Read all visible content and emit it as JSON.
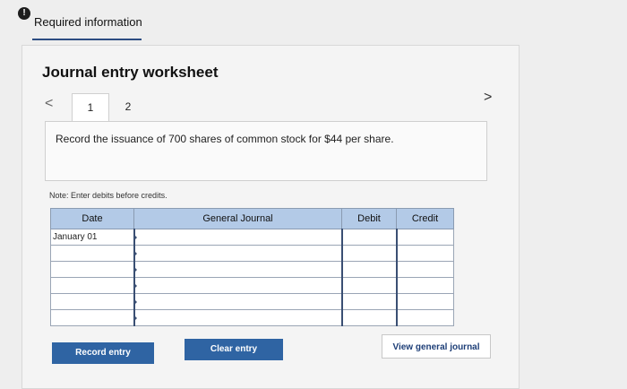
{
  "info": {
    "icon": "!",
    "label": "Required information"
  },
  "worksheet": {
    "title": "Journal entry worksheet",
    "tabs": [
      "1",
      "2"
    ],
    "nav_prev": "<",
    "nav_next": ">",
    "prompt": "Record the issuance of 700 shares of common stock for $44 per share.",
    "note": "Note: Enter debits before credits."
  },
  "table": {
    "headers": {
      "date": "Date",
      "journal": "General Journal",
      "debit": "Debit",
      "credit": "Credit"
    },
    "rows": [
      {
        "date": "January 01",
        "journal": "",
        "debit": "",
        "credit": ""
      },
      {
        "date": "",
        "journal": "",
        "debit": "",
        "credit": ""
      },
      {
        "date": "",
        "journal": "",
        "debit": "",
        "credit": ""
      },
      {
        "date": "",
        "journal": "",
        "debit": "",
        "credit": ""
      },
      {
        "date": "",
        "journal": "",
        "debit": "",
        "credit": ""
      },
      {
        "date": "",
        "journal": "",
        "debit": "",
        "credit": ""
      }
    ]
  },
  "buttons": {
    "record": "Record entry",
    "clear": "Clear entry",
    "view": "View general journal"
  }
}
